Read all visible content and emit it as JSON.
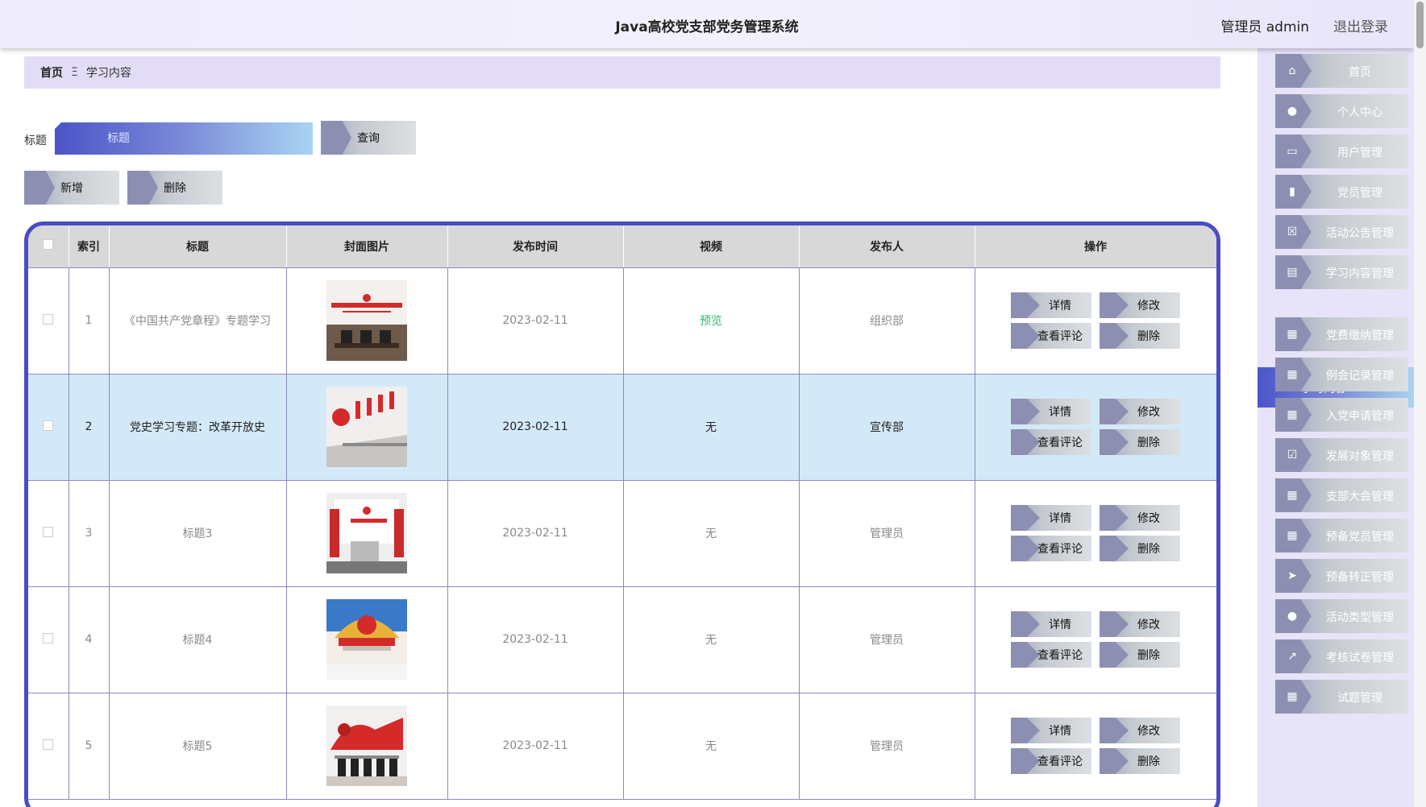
{
  "header": {
    "title": "Java高校党支部党务管理系统",
    "user": "管理员 admin",
    "logout": "退出登录"
  },
  "breadcrumb": {
    "home": "首页",
    "separator": "Ξ",
    "current": "学习内容"
  },
  "search": {
    "label": "标题",
    "placeholder": "标题",
    "query_button": "查询"
  },
  "actions": {
    "add": "新增",
    "delete": "删除"
  },
  "table": {
    "headers": [
      "索引",
      "标题",
      "封面图片",
      "发布时间",
      "视频",
      "发布人",
      "操作"
    ],
    "ops": {
      "detail": "详情",
      "edit": "修改",
      "comments": "查看评论",
      "delete": "删除"
    },
    "rows": [
      {
        "index": "1",
        "title": "《中国共产党章程》专题学习",
        "date": "2023-02-11",
        "video": "预览",
        "publisher": "组织部"
      },
      {
        "index": "2",
        "title": "党史学习专题：改革开放史",
        "date": "2023-02-11",
        "video": "无",
        "publisher": "宣传部"
      },
      {
        "index": "3",
        "title": "标题3",
        "date": "2023-02-11",
        "video": "无",
        "publisher": "管理员"
      },
      {
        "index": "4",
        "title": "标题4",
        "date": "2023-02-11",
        "video": "无",
        "publisher": "管理员"
      },
      {
        "index": "5",
        "title": "标题5",
        "date": "2023-02-11",
        "video": "无",
        "publisher": "管理员"
      }
    ]
  },
  "sidebar": {
    "items": [
      {
        "label": "首页",
        "icon": "home-icon"
      },
      {
        "label": "个人中心",
        "icon": "user-icon"
      },
      {
        "label": "用户管理",
        "icon": "monitor-icon"
      },
      {
        "label": "党员管理",
        "icon": "book-icon"
      },
      {
        "label": "活动公告管理",
        "icon": "clipboard-x-icon"
      },
      {
        "label": "学习内容管理",
        "icon": "clipboard-icon"
      },
      {
        "label": "党费缴纳管理",
        "icon": "grid-icon"
      },
      {
        "label": "例会记录管理",
        "icon": "grid-icon"
      },
      {
        "label": "入党申请管理",
        "icon": "grid-icon"
      },
      {
        "label": "发展对象管理",
        "icon": "clipboard-check-icon"
      },
      {
        "label": "支部大会管理",
        "icon": "grid-icon"
      },
      {
        "label": "预备党员管理",
        "icon": "grid-icon"
      },
      {
        "label": "预备转正管理",
        "icon": "send-icon"
      },
      {
        "label": "活动类型管理",
        "icon": "user-icon"
      },
      {
        "label": "考核试卷管理",
        "icon": "chart-icon"
      },
      {
        "label": "试题管理",
        "icon": "grid-icon"
      }
    ],
    "active": "学习内容"
  },
  "colors": {
    "accent": "#4a4cc4",
    "header_bg": "#eeebfb",
    "breadcrumb_bg": "#e3dcf7",
    "row_active": "#d3e9f8",
    "preview": "#2fb86e"
  }
}
